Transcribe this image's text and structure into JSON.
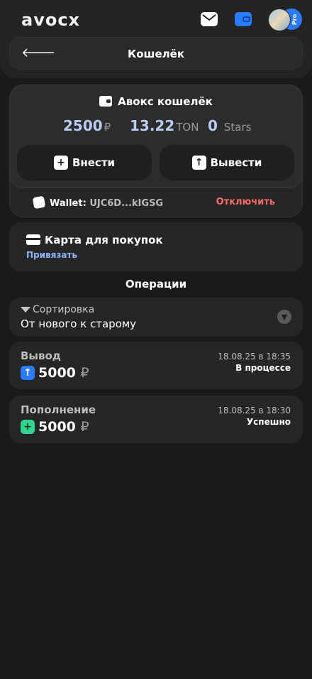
{
  "app": {
    "logo": "avocx",
    "pro_badge": "Pro"
  },
  "header": {
    "title": "Кошелёк",
    "back": "🡐"
  },
  "wallet": {
    "title": "Авокс кошелёк",
    "balances": [
      {
        "value": "2500",
        "unit": "₽"
      },
      {
        "value": "13.22",
        "unit": "TON"
      },
      {
        "value": "0",
        "unit": "Stars"
      }
    ],
    "deposit_label": "Внести",
    "withdraw_label": "Вывести",
    "wallet_label": "Wallet:",
    "wallet_addr": "UJC6D...kIGSG",
    "disconnect_label": "Отключить"
  },
  "purchase_card": {
    "title": "Карта для покупок",
    "link": "Привязать"
  },
  "operations": {
    "title": "Операции",
    "sort_label": "Сортировка",
    "sort_value": "От нового к старому",
    "items": [
      {
        "type": "Вывод",
        "amount": "5000",
        "currency": "₽",
        "date": "18.08.25 в 18:35",
        "status": "В процессе",
        "sign": "↑",
        "color": "#2b7bff"
      },
      {
        "type": "Пополнение",
        "amount": "5000",
        "currency": "₽",
        "date": "18.08.25 в 18:30",
        "status": "Успешно",
        "sign": "+",
        "color": "#2fd58a"
      }
    ]
  }
}
